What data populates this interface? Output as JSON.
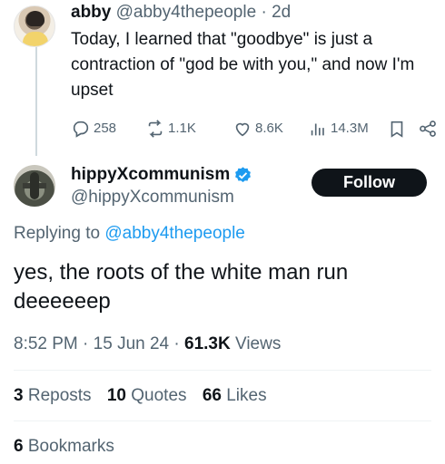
{
  "parent_tweet": {
    "display_name": "abby",
    "handle": "@abby4thepeople",
    "separator": "·",
    "age": "2d",
    "text": "Today, I learned that \"goodbye\" is just a contraction of \"god be with you,\" and now I'm upset",
    "actions": {
      "replies": "258",
      "reposts": "1.1K",
      "likes": "8.6K",
      "views": "14.3M"
    }
  },
  "main_tweet": {
    "display_name": "hippyXcommunism",
    "handle": "@hippyXcommunism",
    "follow_label": "Follow",
    "replying_prefix": "Replying to",
    "replying_handle": "@abby4thepeople",
    "text": "yes, the roots of the white man run deeeeeep",
    "time": "8:52 PM",
    "date": "15 Jun 24",
    "separator": "·",
    "views_count": "61.3K",
    "views_label": "Views",
    "stats": {
      "reposts_count": "3",
      "reposts_label": "Reposts",
      "quotes_count": "10",
      "quotes_label": "Quotes",
      "likes_count": "66",
      "likes_label": "Likes",
      "bookmarks_count": "6",
      "bookmarks_label": "Bookmarks"
    }
  },
  "colors": {
    "text_primary": "#0f1419",
    "text_secondary": "#536471",
    "link": "#1d9bf0",
    "verified": "#1d9bf0",
    "button_bg": "#0f1419"
  },
  "icons": [
    "reply-icon",
    "repost-icon",
    "like-icon",
    "views-icon",
    "bookmark-icon",
    "share-icon",
    "verified-badge-icon"
  ]
}
